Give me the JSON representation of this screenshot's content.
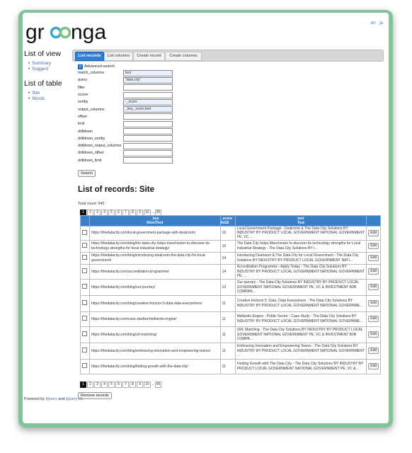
{
  "header": {
    "logo_text": "groonga",
    "lang_en": "en",
    "lang_ja": "ja"
  },
  "sidebar": {
    "view_heading": "List of view",
    "view_items": [
      "Summary",
      "Suggest"
    ],
    "table_heading": "List of table",
    "table_items": [
      "Site",
      "Words"
    ]
  },
  "tabs": [
    "List records",
    "List columns",
    "Create record",
    "Create columns"
  ],
  "form": {
    "advanced_label": "Advanced search",
    "fields": [
      {
        "label": "match_columns",
        "value": "text"
      },
      {
        "label": "query",
        "value": "\"data city\""
      },
      {
        "label": "filter",
        "value": ""
      },
      {
        "label": "scorer",
        "value": ""
      },
      {
        "label": "sortby",
        "value": "-_score"
      },
      {
        "label": "output_columns",
        "value": "_key,_score,text"
      },
      {
        "label": "offset",
        "value": ""
      },
      {
        "label": "limit",
        "value": ""
      },
      {
        "label": "drilldown",
        "value": ""
      },
      {
        "label": "drilldown_sortby",
        "value": ""
      },
      {
        "label": "drilldown_output_columns",
        "value": ""
      },
      {
        "label": "drilldown_offset",
        "value": ""
      },
      {
        "label": "drilldown_limit",
        "value": ""
      }
    ],
    "search_label": "Search"
  },
  "records": {
    "title": "List of records: Site",
    "total": "Total count: 945",
    "pager": [
      "1",
      "2",
      "3",
      "4",
      "5",
      "6",
      "7",
      "8",
      "9",
      "10",
      "...",
      "95"
    ],
    "pager_bottom": [
      "1",
      "2",
      "3",
      "4",
      "5",
      "6",
      "7",
      "8",
      "9",
      "10",
      "...",
      "95"
    ],
    "columns": [
      {
        "name": "_key",
        "type": "ShortText"
      },
      {
        "name": "_score",
        "type": "Int32"
      },
      {
        "name": "text",
        "type": "Text"
      }
    ],
    "rows": [
      {
        "key": "https://thedatacity.com/local-government-package-with-dealroom/",
        "score": "16",
        "text": "Local Government Package - Dealroom & The Data City Solutions BY INDUSTRY BY PRODUCT LOCAL GOVERNMENT NATIONAL GOVERNMENT PE, VC ..."
      },
      {
        "key": "https://thedatacity.com/blog/the-data-city-helps-manchester-to-discover-its-technology-strengths-for-local-industrial-strategy/",
        "score": "16",
        "text": "The Data City helps Manchester to discover its technology strengths for Local Industrial Strategy - The Data City Solutions BY I..."
      },
      {
        "key": "https://thedatacity.com/blog/introducing-dealroom-the-data-city-for-local-government/",
        "score": "14",
        "text": "Introducing Dealroom & The Data City for Local Government - The Data City Solutions BY INDUSTRY BY PRODUCT LOCAL GOVERNMENT NATI..."
      },
      {
        "key": "https://thedatacity.com/accreditation-programme/",
        "score": "14",
        "text": "Accreditation Programme - Apply Today - The Data City Solutions BY INDUSTRY BY PRODUCT LOCAL GOVERNMENT NATIONAL GOVERNMENT PE, ..."
      },
      {
        "key": "https://thedatacity.com/blog/our-journey/",
        "score": "12",
        "text": "Our journey - The Data City Solutions BY INDUSTRY BY PRODUCT LOCAL GOVERNMENT NATIONAL GOVERNMENT PE, VC & INVESTMENT B2B COMPAN..."
      },
      {
        "key": "https://thedatacity.com/blog/creative-horizon-5-data-data-everywhere/",
        "score": "11",
        "text": "Creative Horizon 5: Data, Data Everywhere - The Data City Solutions BY INDUSTRY BY PRODUCT LOCAL GOVERNMENT NATIONAL GOVERNME..."
      },
      {
        "key": "https://thedatacity.com/case-studies/midlands-engine/",
        "score": "11",
        "text": "Midlands Engine - Public Sector - Case Study - The Data City Solutions BY INDUSTRY BY PRODUCT LOCAL GOVERNMENT NATIONAL GOVERNME..."
      },
      {
        "key": "https://thedatacity.com/blog/url-matching/",
        "score": "11",
        "text": "URL Matching - The Data City Solutions BY INDUSTRY BY PRODUCT LOCAL GOVERNMENT NATIONAL GOVERNMENT PE, VC & INVESTMENT B2B COMPA..."
      },
      {
        "key": "https://thedatacity.com/blog/embracing-innovation-and-empowering-teams/",
        "score": "11",
        "text": "Embracing Innovation and Empowering Teams - The Data City Solutions BY INDUSTRY BY PRODUCT LOCAL GOVERNMENT NATIONAL GOVERNMENT ..."
      },
      {
        "key": "https://thedatacity.com/blog/finding-growth-with-the-data-city/",
        "score": "11",
        "text": "Finding Growth with The Data City - The Data City Solutions BY INDUSTRY BY PRODUCT LOCAL GOVERNMENT NATIONAL GOVERNMENT PE, VC &..."
      }
    ],
    "edit_label": "Edit",
    "remove_label": "Remove records"
  },
  "footer": {
    "prefix": "Powered by ",
    "jquery": "jQuery",
    "and": " and ",
    "jqueryui": "jQuery UI",
    "suffix": "."
  },
  "colors": {
    "frame": "#7fc49b",
    "tab_active": "#2f7fdc",
    "table_header": "#3a80c8",
    "link": "#3a6fb0"
  }
}
